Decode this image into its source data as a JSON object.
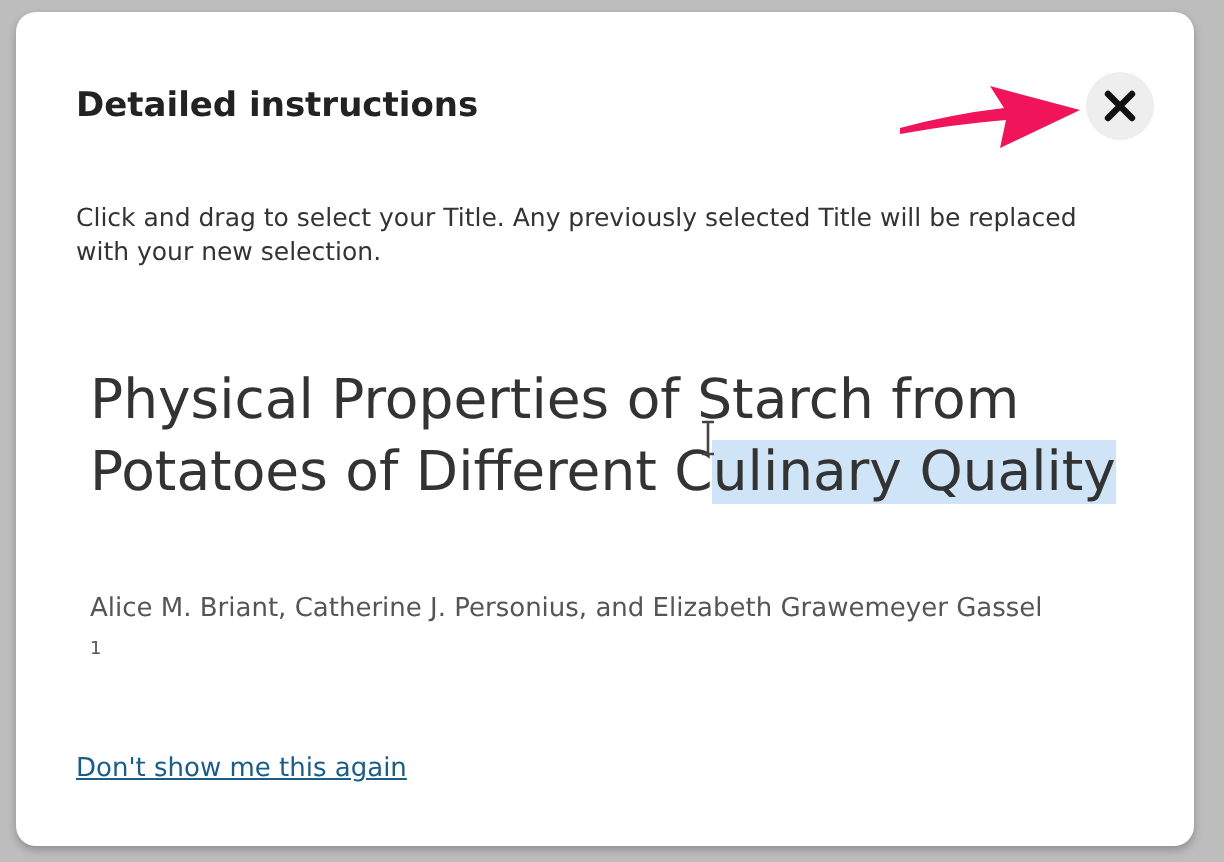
{
  "dialog": {
    "title": "Detailed instructions",
    "instructions": "Click and drag to select your Title. Any previously selected Title will be replaced with your new selection.",
    "document_title_unselected": "Physical Properties of Starch from Potatoes of Different C",
    "document_title_selected": "ulinary Quality",
    "authors": "Alice M. Briant, Catherine J. Personius, and Elizabeth Grawemeyer Gassel $^{1}$",
    "link": "Don't show me this again"
  }
}
